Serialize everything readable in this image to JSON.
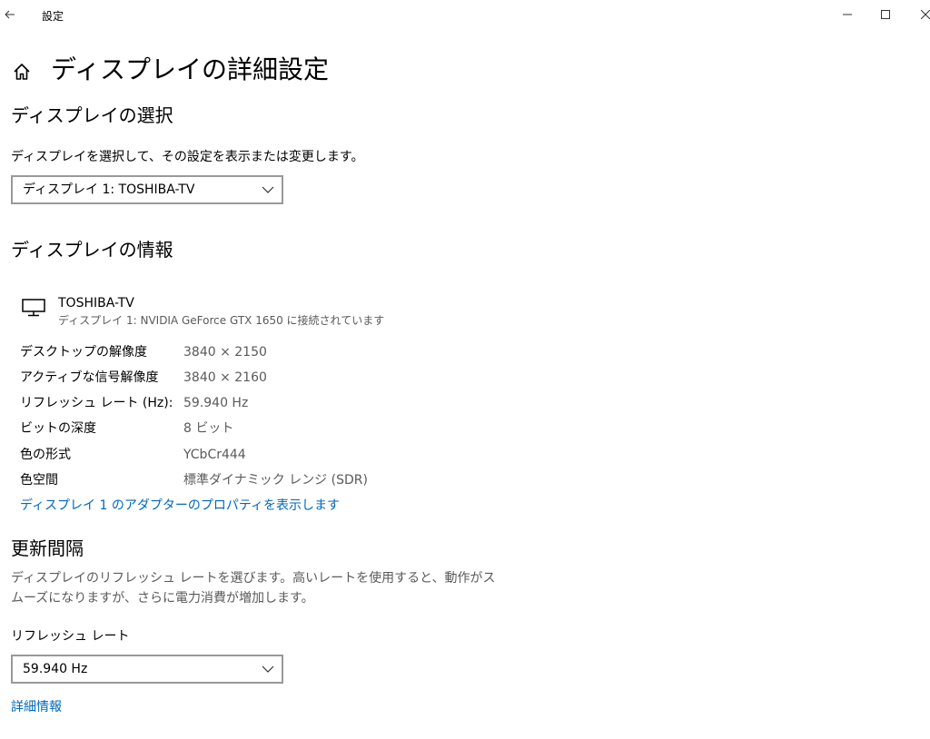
{
  "window": {
    "title": "設定",
    "back_icon": "back-arrow-icon",
    "minimize_icon": "minimize-icon",
    "maximize_icon": "maximize-icon",
    "close_icon": "close-icon"
  },
  "page": {
    "title": "ディスプレイの詳細設定",
    "home_icon": "home-icon"
  },
  "display_select": {
    "heading": "ディスプレイの選択",
    "description": "ディスプレイを選択して、その設定を表示または変更します。",
    "selected": "ディスプレイ 1: TOSHIBA-TV"
  },
  "display_info": {
    "heading": "ディスプレイの情報",
    "monitor_icon": "monitor-icon",
    "name": "TOSHIBA-TV",
    "subtitle": "ディスプレイ 1: NVIDIA GeForce GTX 1650 に接続されています",
    "properties": [
      {
        "label": "デスクトップの解像度",
        "value": "3840 × 2150"
      },
      {
        "label": "アクティブな信号解像度",
        "value": "3840 × 2160"
      },
      {
        "label": "リフレッシュ レート (Hz):",
        "value": "59.940 Hz"
      },
      {
        "label": "ビットの深度",
        "value": "8 ビット"
      },
      {
        "label": "色の形式",
        "value": "YCbCr444"
      },
      {
        "label": "色空間",
        "value": "標準ダイナミック レンジ (SDR)"
      }
    ],
    "adapter_link": "ディスプレイ 1 のアダプターのプロパティを表示します"
  },
  "refresh": {
    "heading": "更新間隔",
    "description_line1": "ディスプレイのリフレッシュ レートを選びます。高いレートを使用すると、動作がス",
    "description_line2": "ムーズになりますが、さらに電力消費が増加します。",
    "label": "リフレッシュ レート",
    "selected": "59.940 Hz",
    "details_link": "詳細情報"
  },
  "colors": {
    "accent": "#0067b8",
    "secondary_text": "#5a5a5a",
    "combo_border": "#999999"
  }
}
